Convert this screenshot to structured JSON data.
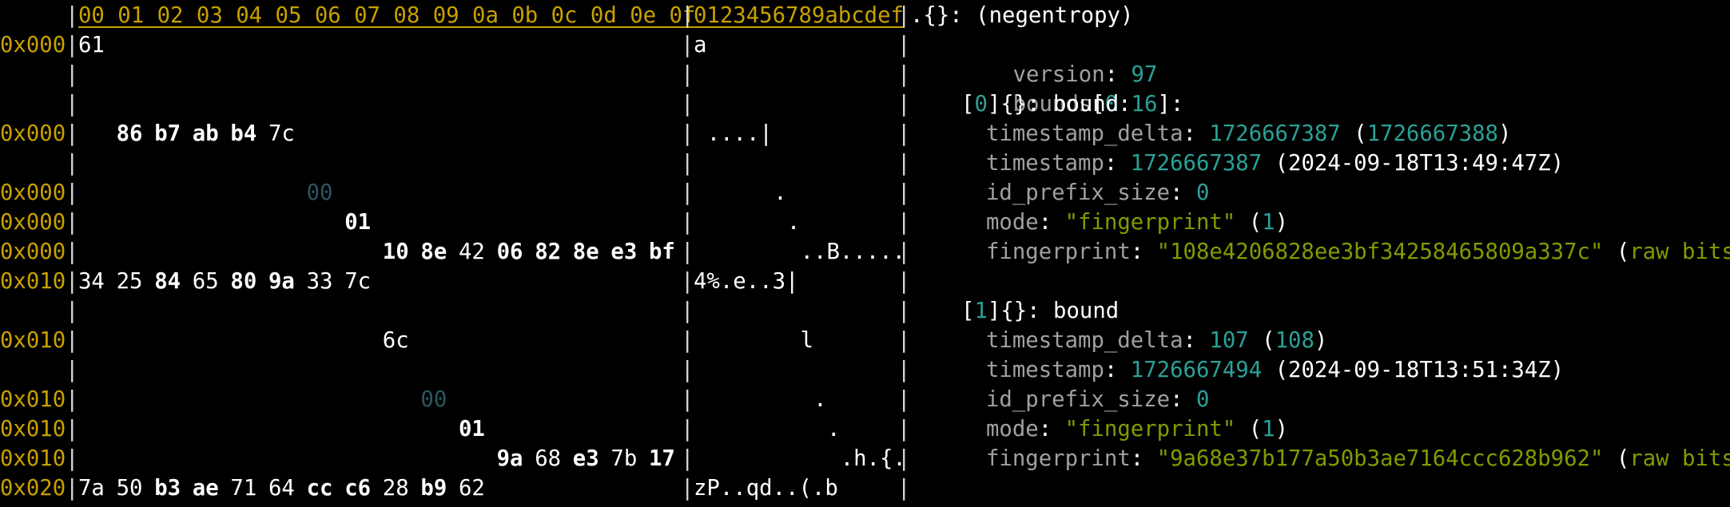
{
  "header": {
    "hex_columns": "00 01 02 03 04 05 06 07 08 09 0a 0b 0c 0d 0e 0f",
    "ascii_columns": "0123456789abcdef",
    "root_label": ".{}: (negentropy)"
  },
  "colors": {
    "background": "#000000",
    "address": "#c8a000",
    "key": "#a0a0a0",
    "number": "#2aa198",
    "string": "#859900",
    "dim_byte": "#2a5560"
  },
  "hex_rows": [
    {
      "addr": "0x000",
      "bytes": [
        {
          "v": "61",
          "b": false
        }
      ],
      "ascii": "a"
    },
    {
      "addr": "",
      "bytes": [],
      "ascii": ""
    },
    {
      "addr": "",
      "bytes": [],
      "ascii": ""
    },
    {
      "addr": "0x000",
      "bytes": [
        {
          "v": "86",
          "b": true
        },
        {
          "v": "b7",
          "b": true
        },
        {
          "v": "ab",
          "b": true
        },
        {
          "v": "b4",
          "b": true
        },
        {
          "v": "7c",
          "b": false
        }
      ],
      "ascii": "....|"
    },
    {
      "addr": "",
      "bytes": [],
      "ascii": ""
    },
    {
      "addr": "0x000",
      "bytes": [
        {
          "v": "00",
          "b": false,
          "dim": true
        }
      ],
      "ascii": "."
    },
    {
      "addr": "0x000",
      "bytes": [
        {
          "v": "01",
          "b": true
        }
      ],
      "ascii": "."
    },
    {
      "addr": "0x000",
      "bytes": [
        {
          "v": "10",
          "b": true
        },
        {
          "v": "8e",
          "b": true
        },
        {
          "v": "42",
          "b": false
        },
        {
          "v": "06",
          "b": true
        },
        {
          "v": "82",
          "b": true
        },
        {
          "v": "8e",
          "b": true
        },
        {
          "v": "e3",
          "b": true
        },
        {
          "v": "bf",
          "b": true
        }
      ],
      "ascii": "..B....."
    },
    {
      "addr": "0x010",
      "bytes": [
        {
          "v": "34",
          "b": false
        },
        {
          "v": "25",
          "b": false
        },
        {
          "v": "84",
          "b": true
        },
        {
          "v": "65",
          "b": false
        },
        {
          "v": "80",
          "b": true
        },
        {
          "v": "9a",
          "b": true
        },
        {
          "v": "33",
          "b": false
        },
        {
          "v": "7c",
          "b": false
        }
      ],
      "ascii": "4%.e..3|"
    },
    {
      "addr": "",
      "bytes": [],
      "ascii": ""
    },
    {
      "addr": "0x010",
      "bytes": [
        {
          "v": "6c",
          "b": false
        }
      ],
      "ascii": "l"
    },
    {
      "addr": "",
      "bytes": [],
      "ascii": ""
    },
    {
      "addr": "0x010",
      "bytes": [
        {
          "v": "00",
          "b": false,
          "dim": true
        }
      ],
      "ascii": "."
    },
    {
      "addr": "0x010",
      "bytes": [
        {
          "v": "01",
          "b": true
        }
      ],
      "ascii": "."
    },
    {
      "addr": "0x010",
      "bytes": [
        {
          "v": "9a",
          "b": true
        },
        {
          "v": "68",
          "b": false
        },
        {
          "v": "e3",
          "b": true
        },
        {
          "v": "7b",
          "b": false
        },
        {
          "v": "17",
          "b": true
        }
      ],
      "ascii": ".h.{."
    },
    {
      "addr": "0x020",
      "bytes": [
        {
          "v": "7a",
          "b": false
        },
        {
          "v": "50",
          "b": false
        },
        {
          "v": "b3",
          "b": true
        },
        {
          "v": "ae",
          "b": true
        },
        {
          "v": "71",
          "b": false
        },
        {
          "v": "64",
          "b": false
        },
        {
          "v": "cc",
          "b": true
        },
        {
          "v": "c6",
          "b": true
        },
        {
          "v": "28",
          "b": false
        },
        {
          "v": "b9",
          "b": true
        },
        {
          "v": "62",
          "b": false
        }
      ],
      "ascii": "zP..qd..(.b"
    }
  ],
  "tree": {
    "version_key": "version",
    "version_val": "97",
    "bounds_key": "bounds",
    "bounds_start": "0",
    "bounds_end": "16",
    "bounds_tail": "]:",
    "items": [
      {
        "index": "0",
        "type_label": "{}: bound",
        "timestamp_delta_key": "timestamp_delta",
        "timestamp_delta": "1726667387",
        "timestamp_delta_raw": "1726667388",
        "timestamp_key": "timestamp",
        "timestamp": "1726667387",
        "timestamp_human": "2024-09-18T13:49:47Z",
        "id_prefix_size_key": "id_prefix_size",
        "id_prefix_size": "0",
        "mode_key": "mode",
        "mode": "\"fingerprint\"",
        "mode_raw": "1",
        "fingerprint_key": "fingerprint",
        "fingerprint": "\"108e4206828ee3bf34258465809a337c\"",
        "fingerprint_raw": "raw bits"
      },
      {
        "index": "1",
        "type_label": "{}: bound",
        "timestamp_delta_key": "timestamp_delta",
        "timestamp_delta": "107",
        "timestamp_delta_raw": "108",
        "timestamp_key": "timestamp",
        "timestamp": "1726667494",
        "timestamp_human": "2024-09-18T13:51:34Z",
        "id_prefix_size_key": "id_prefix_size",
        "id_prefix_size": "0",
        "mode_key": "mode",
        "mode": "\"fingerprint\"",
        "mode_raw": "1",
        "fingerprint_key": "fingerprint",
        "fingerprint": "\"9a68e37b177a50b3ae7164ccc628b962\"",
        "fingerprint_raw": "raw bits"
      }
    ]
  }
}
